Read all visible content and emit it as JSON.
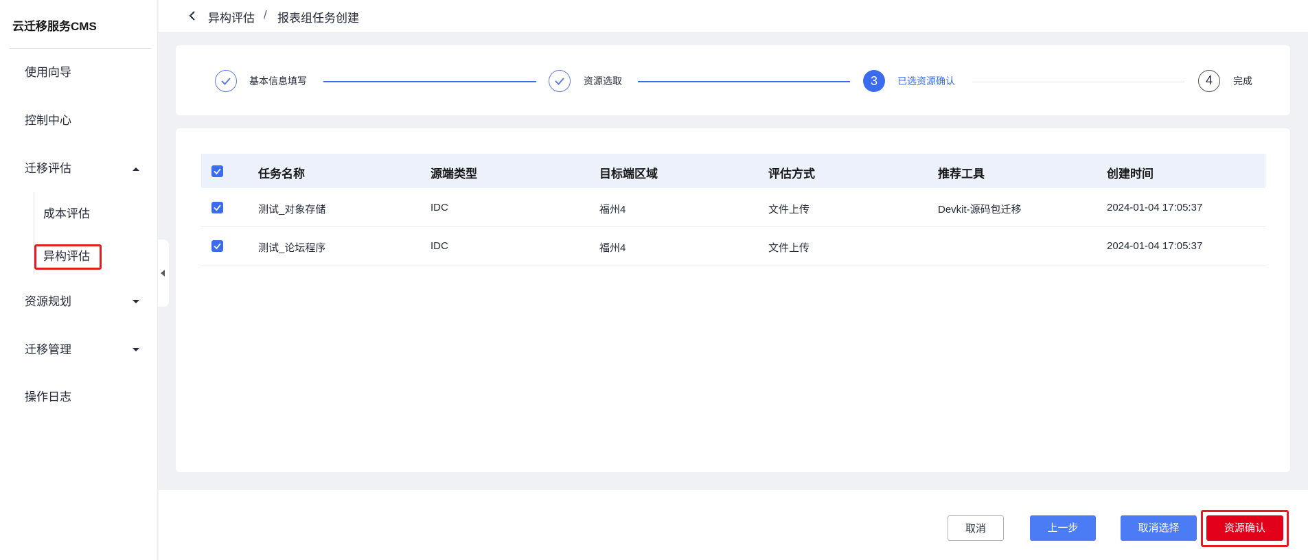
{
  "app": {
    "title": "云迁移服务CMS"
  },
  "sidebar": {
    "items": [
      {
        "label": "使用向导"
      },
      {
        "label": "控制中心"
      },
      {
        "label": "迁移评估",
        "sub": [
          {
            "label": "成本评估"
          },
          {
            "label": "异构评估",
            "selected": true
          }
        ]
      },
      {
        "label": "资源规划"
      },
      {
        "label": "迁移管理"
      },
      {
        "label": "操作日志"
      }
    ]
  },
  "breadcrumb": {
    "parent": "异构评估",
    "separator": "/",
    "current": "报表组任务创建"
  },
  "steps": [
    {
      "label": "基本信息填写",
      "status": "done"
    },
    {
      "label": "资源选取",
      "status": "done"
    },
    {
      "number": "3",
      "label": "已选资源确认",
      "status": "active"
    },
    {
      "number": "4",
      "label": "完成",
      "status": "todo"
    }
  ],
  "table": {
    "headers": [
      "任务名称",
      "源端类型",
      "目标端区域",
      "评估方式",
      "推荐工具",
      "创建时间"
    ],
    "rows": [
      {
        "checked": true,
        "name": "测试_对象存储",
        "source_type": "IDC",
        "target_region": "福州4",
        "method": "文件上传",
        "tool": "Devkit-源码包迁移",
        "created": "2024-01-04 17:05:37"
      },
      {
        "checked": true,
        "name": "测试_论坛程序",
        "source_type": "IDC",
        "target_region": "福州4",
        "method": "文件上传",
        "tool": "",
        "created": "2024-01-04 17:05:37"
      }
    ]
  },
  "footer": {
    "cancel_label": "取消",
    "prev_label": "上一步",
    "deselect_label": "取消选择",
    "confirm_label": "资源确认"
  },
  "colors": {
    "primary": "#3b6cf0",
    "danger": "#e3001b",
    "highlight": "#e11d21"
  }
}
